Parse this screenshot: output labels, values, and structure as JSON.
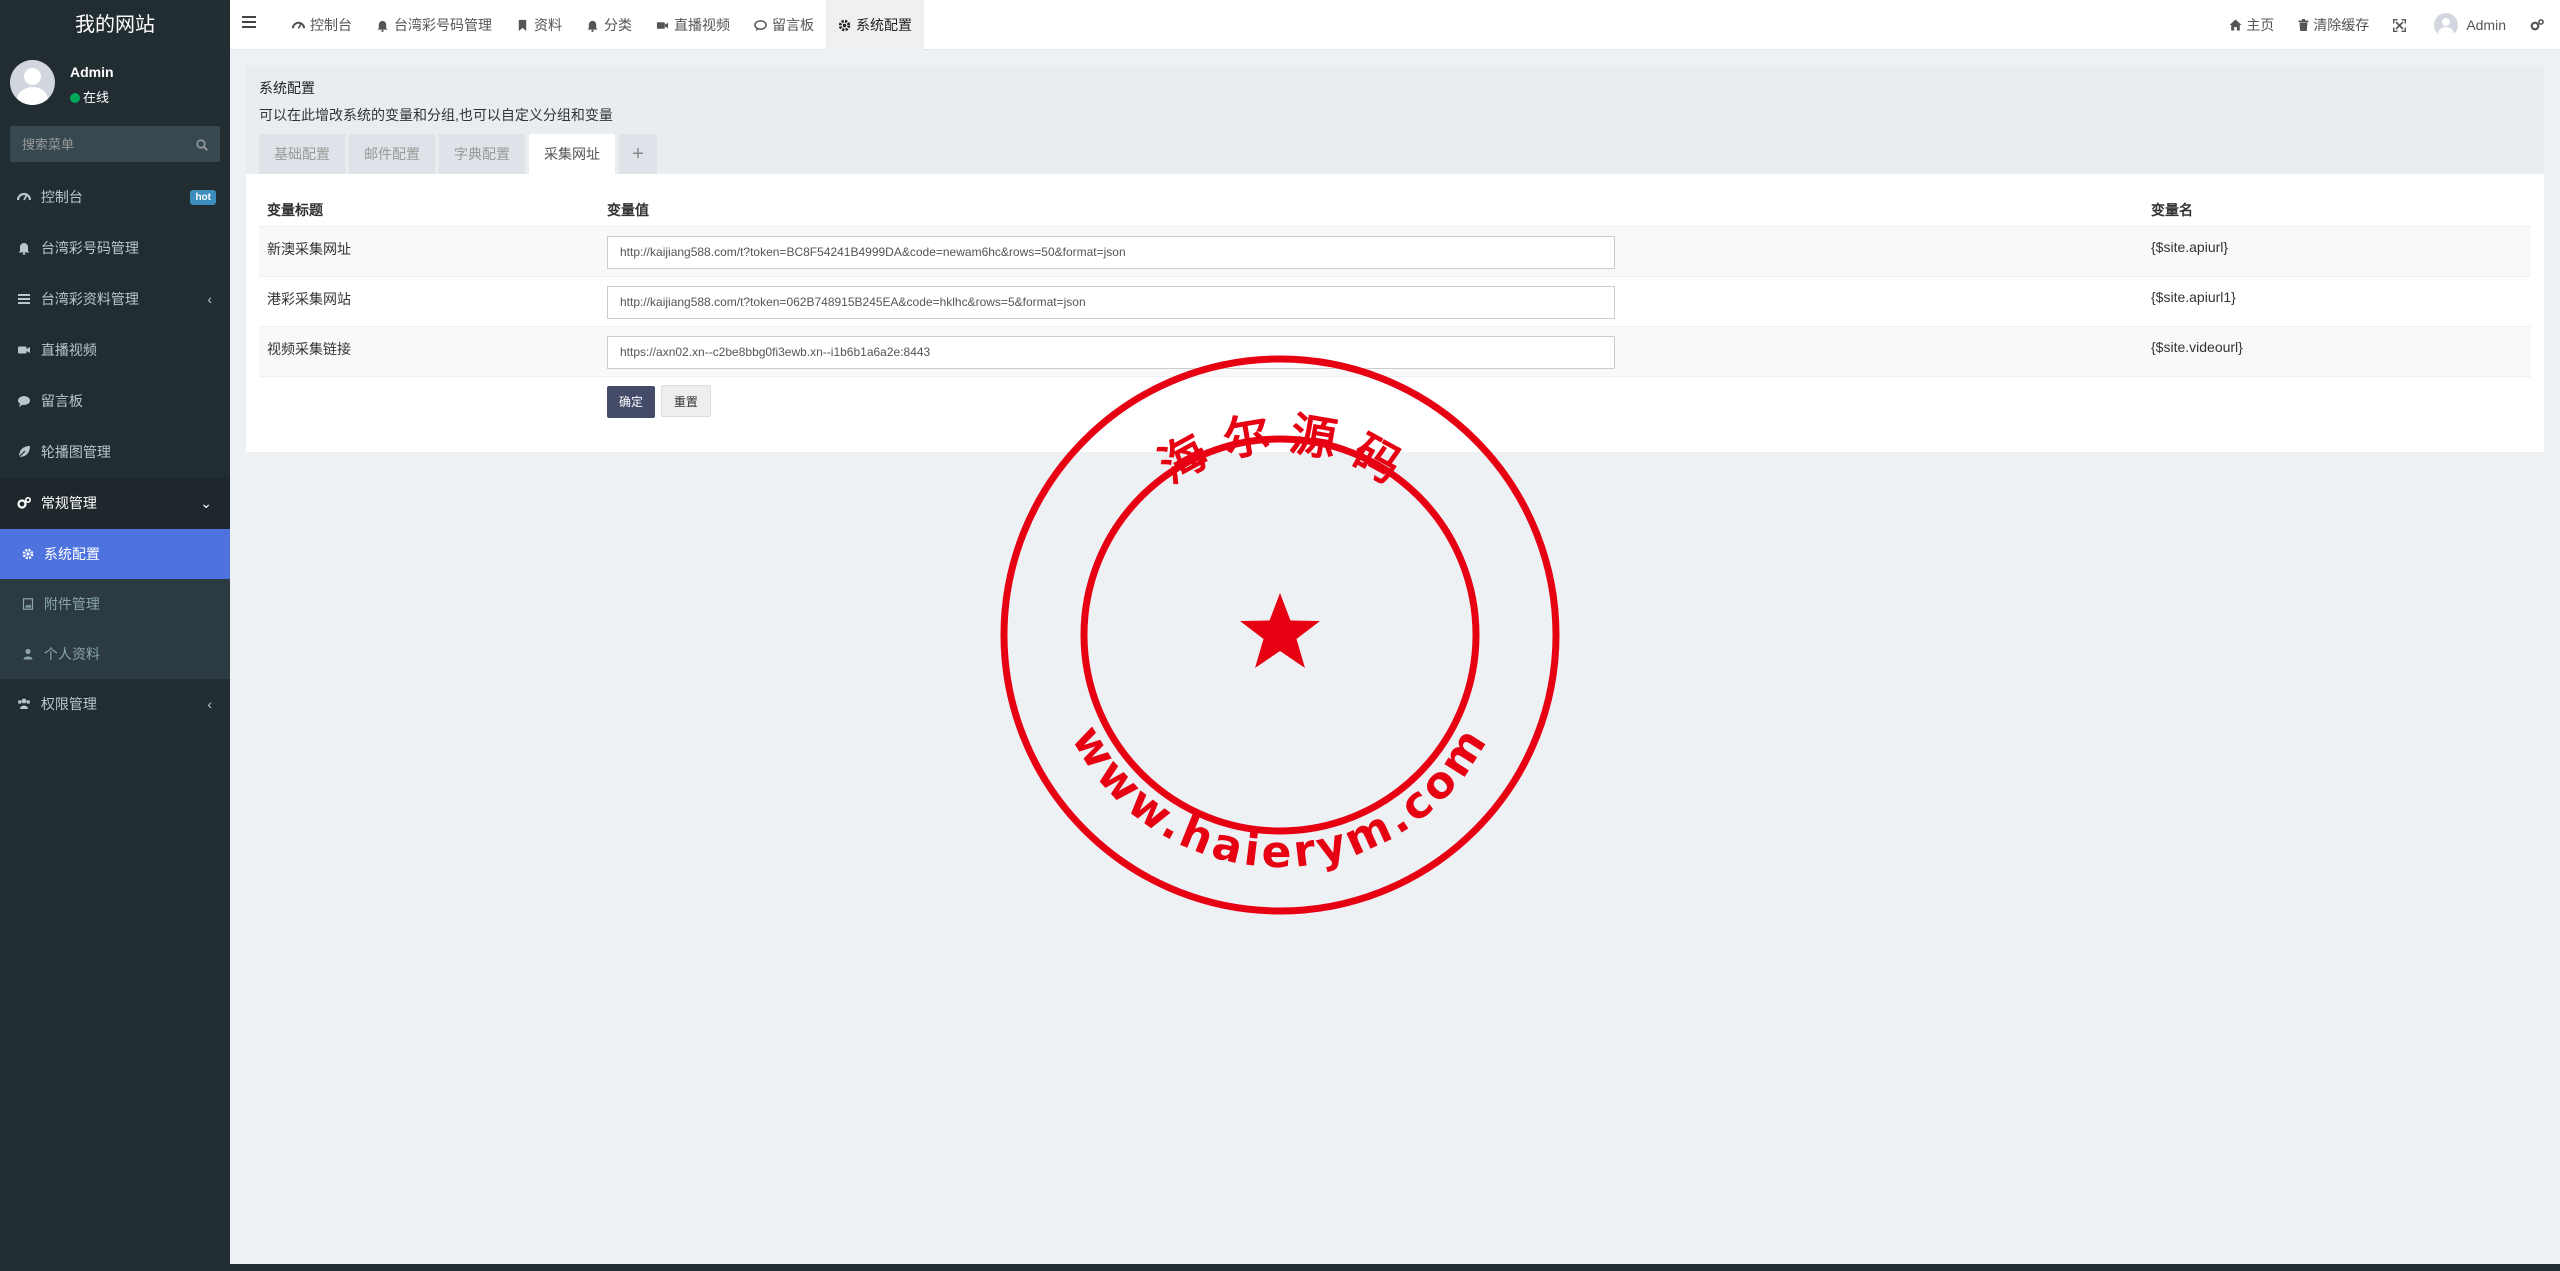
{
  "sidebar": {
    "logo": "我的网站",
    "user": {
      "name": "Admin",
      "status": "在线"
    },
    "search": {
      "placeholder": "搜索菜单"
    },
    "menu": [
      {
        "label": "控制台",
        "icon": "dashboard-icon",
        "badge": "hot"
      },
      {
        "label": "台湾彩号码管理",
        "icon": "bell-icon"
      },
      {
        "label": "台湾彩资料管理",
        "icon": "list-icon"
      },
      {
        "label": "直播视频",
        "icon": "video-icon"
      },
      {
        "label": "留言板",
        "icon": "comment-icon"
      },
      {
        "label": "轮播图管理",
        "icon": "leaf-icon"
      },
      {
        "label": "常规管理",
        "icon": "cogs-icon"
      },
      {
        "label": "权限管理",
        "icon": "users-icon"
      }
    ],
    "submenu": [
      {
        "label": "系统配置",
        "icon": "gear-icon"
      },
      {
        "label": "附件管理",
        "icon": "file-image-icon"
      },
      {
        "label": "个人资料",
        "icon": "user-icon"
      }
    ]
  },
  "header": {
    "tabs": [
      {
        "label": "控制台",
        "icon": "dashboard-icon"
      },
      {
        "label": "台湾彩号码管理",
        "icon": "bell-icon"
      },
      {
        "label": "资料",
        "icon": "bookmark-icon"
      },
      {
        "label": "分类",
        "icon": "bell-icon"
      },
      {
        "label": "直播视频",
        "icon": "video-icon"
      },
      {
        "label": "留言板",
        "icon": "comment-icon"
      },
      {
        "label": "系统配置",
        "icon": "gear-icon"
      }
    ],
    "right": {
      "home": "主页",
      "clear_cache": "清除缓存",
      "user": "Admin"
    }
  },
  "page": {
    "title": "系统配置",
    "description": "可以在此增改系统的变量和分组,也可以自定义分组和变量",
    "config_tabs": [
      "基础配置",
      "邮件配置",
      "字典配置",
      "采集网址"
    ],
    "add_tab": "+",
    "table": {
      "headers": [
        "变量标题",
        "变量值",
        "变量名"
      ],
      "rows": [
        {
          "title": "新澳采集网址",
          "value": "http://kaijiang588.com/t?token=BC8F54241B4999DA&code=newam6hc&rows=50&format=json",
          "name": "{$site.apiurl}"
        },
        {
          "title": "港彩采集网站",
          "value": "http://kaijiang588.com/t?token=062B748915B245EA&code=hklhc&rows=5&format=json",
          "name": "{$site.apiurl1}"
        },
        {
          "title": "视频采集链接",
          "value": "https://axn02.xn--c2be8bbg0fi3ewb.xn--i1b6b1a6a2e:8443",
          "name": "{$site.videourl}"
        }
      ]
    },
    "buttons": {
      "ok": "确定",
      "reset": "重置"
    }
  },
  "watermark": {
    "top_text": "海 尔 源 码",
    "bottom_text": "www.haierym.com",
    "color": "#e60012"
  },
  "colors": {
    "sidebar_bg": "#222d32",
    "active_item": "#4e73df",
    "primary_button": "#444c69"
  }
}
